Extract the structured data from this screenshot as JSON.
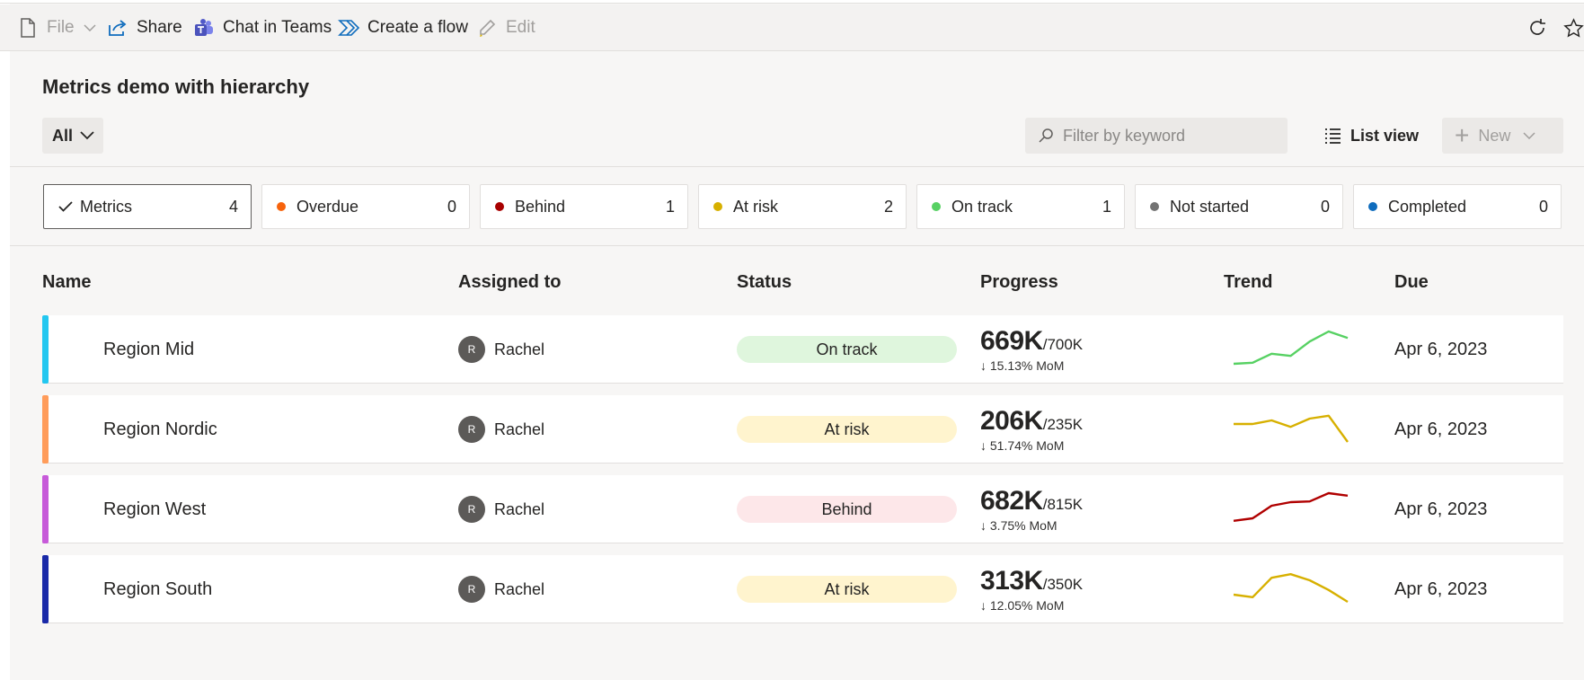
{
  "toolbar": {
    "file_label": "File",
    "share_label": "Share",
    "chat_label": "Chat in Teams",
    "flow_label": "Create a flow",
    "edit_label": "Edit"
  },
  "header": {
    "title": "Metrics demo with hierarchy",
    "filter_value": "All",
    "search_placeholder": "Filter by keyword",
    "view_label": "List view",
    "new_label": "New"
  },
  "status_cards": [
    {
      "label": "Metrics",
      "count": "4",
      "color": null
    },
    {
      "label": "Overdue",
      "count": "0",
      "color": "#f7630c"
    },
    {
      "label": "Behind",
      "count": "1",
      "color": "#a80000"
    },
    {
      "label": "At risk",
      "count": "2",
      "color": "#d7b000"
    },
    {
      "label": "On track",
      "count": "1",
      "color": "#57d163"
    },
    {
      "label": "Not started",
      "count": "0",
      "color": "#737373"
    },
    {
      "label": "Completed",
      "count": "0",
      "color": "#0f6cbd"
    }
  ],
  "columns": {
    "name": "Name",
    "assigned": "Assigned to",
    "status": "Status",
    "progress": "Progress",
    "trend": "Trend",
    "due": "Due"
  },
  "rows": [
    {
      "name": "Region Mid",
      "bar_color": "#23c7f0",
      "avatar": "R",
      "owner": "Rachel",
      "status": "On track",
      "status_bg": "#dff6dd",
      "value": "669K",
      "target": "/700K",
      "mom": "↓ 15.13% MoM",
      "trend_color": "#57d163",
      "trend": [
        0.0,
        0.03,
        0.28,
        0.22,
        0.62,
        0.9,
        0.72
      ],
      "due": "Apr 6, 2023"
    },
    {
      "name": "Region Nordic",
      "bar_color": "#ff9c5a",
      "avatar": "R",
      "owner": "Rachel",
      "status": "At risk",
      "status_bg": "#fff4ce",
      "value": "206K",
      "target": "/235K",
      "mom": "↓ 51.74% MoM",
      "trend_color": "#d7b000",
      "trend": [
        0.55,
        0.55,
        0.65,
        0.47,
        0.7,
        0.78,
        0.05
      ],
      "due": "Apr 6, 2023"
    },
    {
      "name": "Region West",
      "bar_color": "#c75ad9",
      "avatar": "R",
      "owner": "Rachel",
      "status": "Behind",
      "status_bg": "#fde7e9",
      "value": "682K",
      "target": "/815K",
      "mom": "↓ 3.75% MoM",
      "trend_color": "#b00000",
      "trend": [
        0.08,
        0.15,
        0.5,
        0.6,
        0.62,
        0.85,
        0.78
      ],
      "due": "Apr 6, 2023"
    },
    {
      "name": "Region South",
      "bar_color": "#1a2aa8",
      "avatar": "R",
      "owner": "Rachel",
      "status": "At risk",
      "status_bg": "#fff4ce",
      "value": "313K",
      "target": "/350K",
      "mom": "↓ 12.05% MoM",
      "trend_color": "#d7b000",
      "trend": [
        0.25,
        0.18,
        0.72,
        0.82,
        0.65,
        0.38,
        0.05
      ],
      "due": "Apr 6, 2023"
    }
  ]
}
